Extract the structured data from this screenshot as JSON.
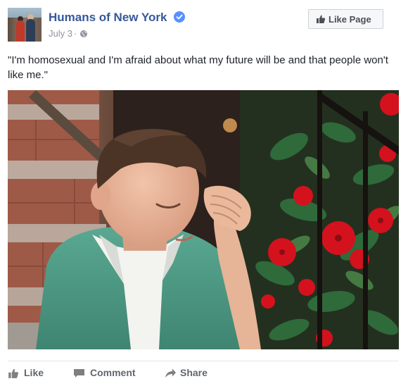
{
  "post": {
    "page_name": "Humans of New York",
    "verified": true,
    "date": "July 3",
    "separator": "·",
    "privacy_icon": "globe-icon",
    "like_page_label": "Like Page",
    "caption": "\"I'm homosexual and I'm afraid about what my future will be and that people won't like me.\""
  },
  "photo": {
    "subject": "boy-with-hand-on-forehead",
    "palette": {
      "sweater": "#4f9a86",
      "collar": "#f3f3f0",
      "skin": "#e8b59a",
      "hair": "#4b3426",
      "brick": "#a0523f",
      "flower": "#d3121e",
      "leaf": "#2f6a3a",
      "railing": "#1a1512"
    }
  },
  "actions": {
    "like_label": "Like",
    "comment_label": "Comment",
    "share_label": "Share"
  },
  "colors": {
    "link_blue": "#365899",
    "meta_grey": "#90949c",
    "action_grey": "#606770",
    "verified_blue": "#5890ff"
  }
}
